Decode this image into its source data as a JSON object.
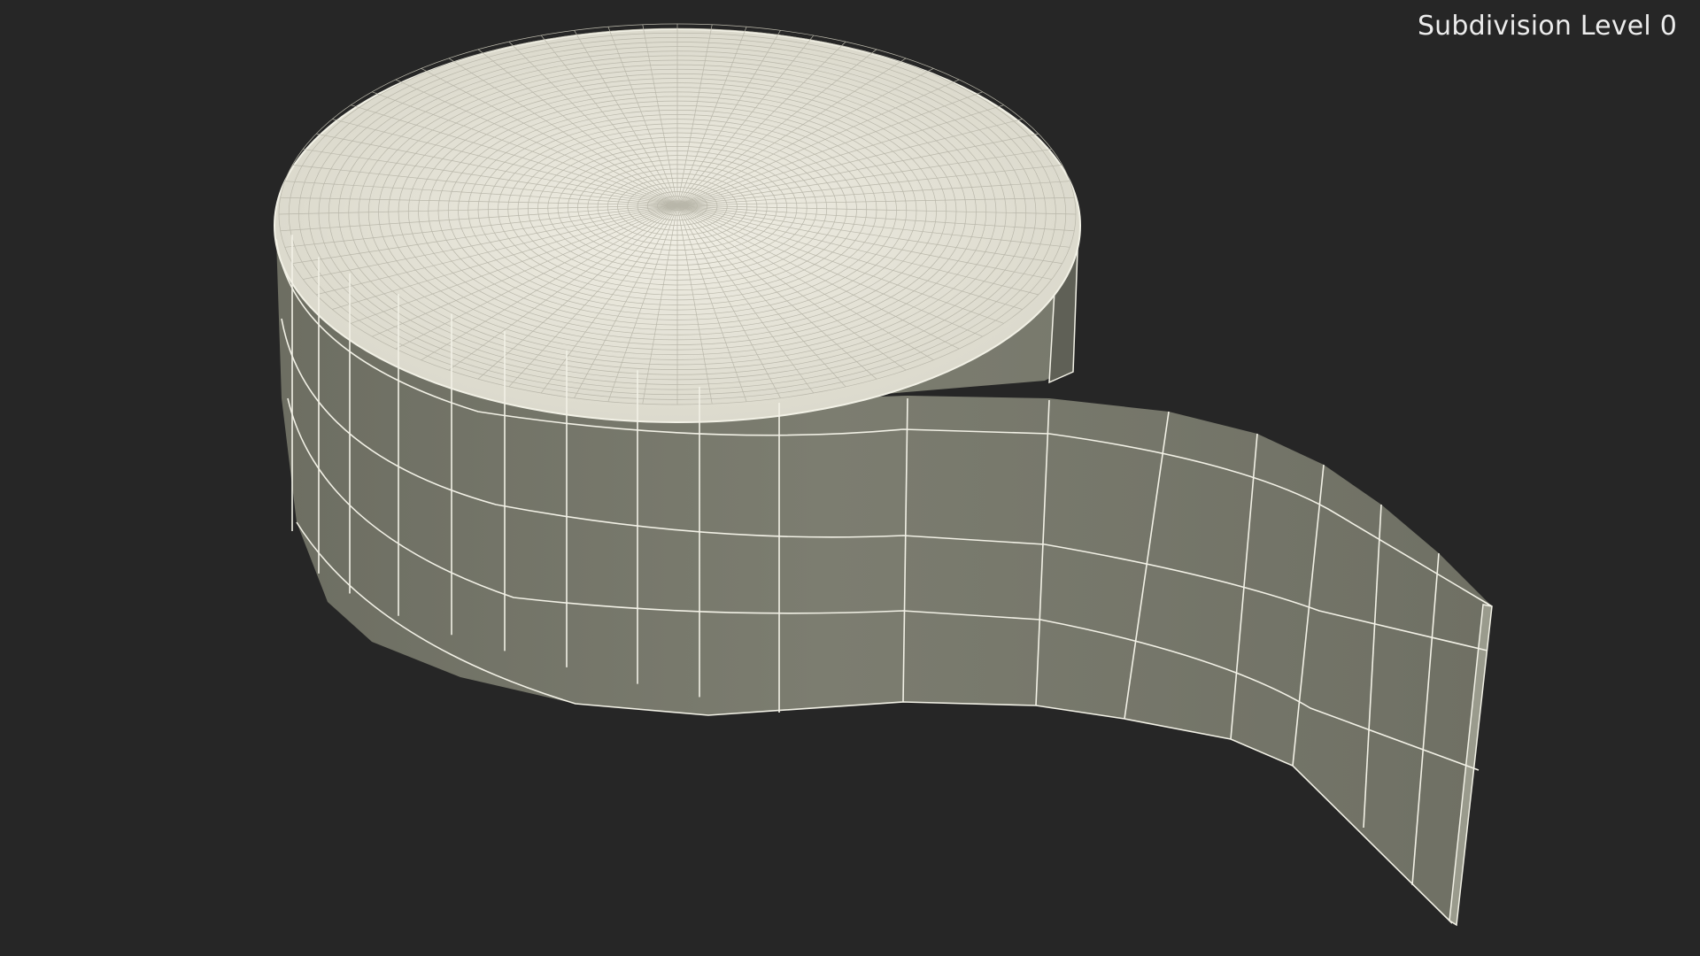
{
  "overlay": {
    "subdivision_label": "Subdivision Level 0"
  },
  "scene": {
    "object": "tape-roll-wireframe",
    "background_color": "#262626",
    "top_face_color": "#e9e7dc",
    "side_face_color": "#7a7b6d",
    "wire_color": "#f2f1e6"
  }
}
